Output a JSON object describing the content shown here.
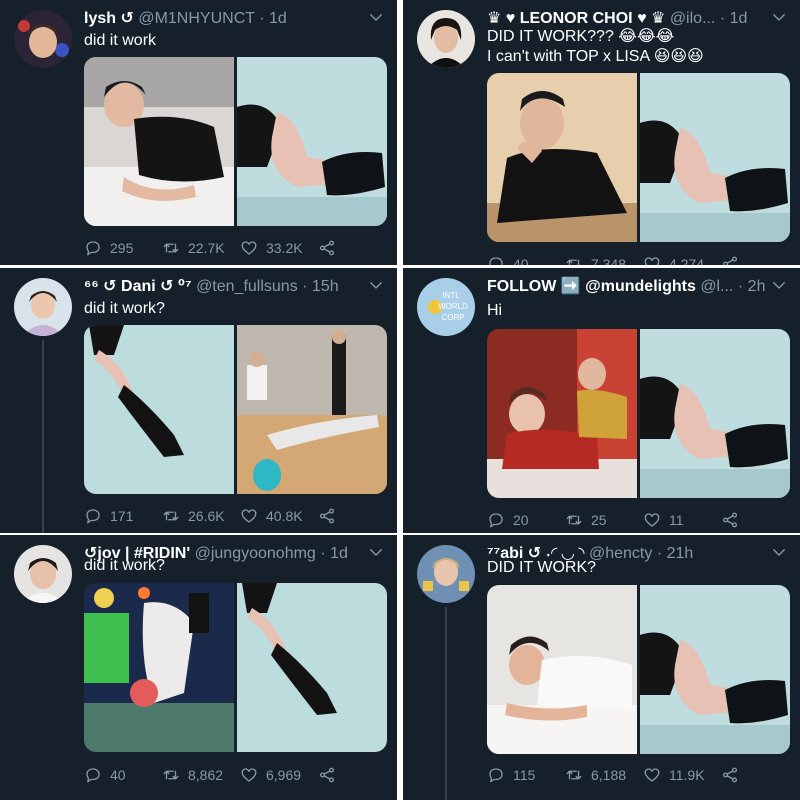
{
  "tweets": [
    {
      "name": "lysh ↺",
      "handle": "@M1NHYUNCT",
      "time": "· 1d",
      "text_lines": [
        "did it work"
      ],
      "replies": "295",
      "retweets": "22.7K",
      "likes": "33.2K"
    },
    {
      "name": "♛ ♥ LEONOR CHOI ♥ ♛",
      "handle": "@ilo...",
      "time": "· 1d",
      "text_lines": [
        "DID IT WORK??? 😂😂😂",
        "I can't with TOP x LISA 😆😆😆"
      ],
      "replies": "40",
      "retweets": "7,348",
      "likes": "4,274"
    },
    {
      "name": "⁶⁶ ↺ Dani ↺ ⁰⁷",
      "handle": "@ten_fullsuns",
      "time": "· 15h",
      "text_lines": [
        "did it work?"
      ],
      "replies": "171",
      "retweets": "26.6K",
      "likes": "40.8K"
    },
    {
      "name": "FOLLOW ➡️",
      "name_extra": "@mundelights",
      "handle": "@l...",
      "time": "· 2h",
      "text_lines": [
        "Hi"
      ],
      "avatar_text": [
        "INTL",
        "WORLD",
        "CORP"
      ],
      "replies": "20",
      "retweets": "25",
      "likes": "11"
    },
    {
      "name": "↺jov | #RIDIN'",
      "handle": "@jungyoonohmg",
      "time": "· 1d",
      "text_lines": [
        "did it work?"
      ],
      "replies": "40",
      "retweets": "8,862",
      "likes": "6,969"
    },
    {
      "name": "⁷⁷abi ↺ ˖◜ ◡ ◝",
      "handle": "@hencty",
      "time": "· 21h",
      "text_lines": [
        "DID IT WORK?"
      ],
      "replies": "115",
      "retweets": "6,188",
      "likes": "11.9K"
    }
  ],
  "colors": {
    "background": "#15202b",
    "text": "#ffffff",
    "muted": "#8899a6",
    "divider": "#ffffff"
  },
  "icons": [
    "reply-icon",
    "retweet-icon",
    "like-icon",
    "share-icon",
    "chevron-down-icon"
  ]
}
